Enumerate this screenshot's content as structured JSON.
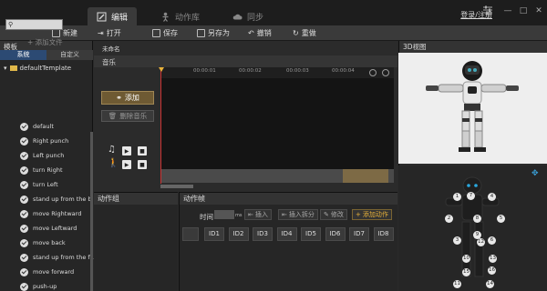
{
  "titlebar": {
    "tabs": [
      {
        "label": "编辑",
        "icon": "edit-icon",
        "active": true
      },
      {
        "label": "动作库",
        "icon": "robot-icon",
        "active": false
      },
      {
        "label": "同步",
        "icon": "cloud-icon",
        "active": false
      }
    ],
    "login": "登录/注册",
    "window_buttons": [
      "settings-icon",
      "minimize-icon",
      "maximize-icon",
      "close-icon"
    ]
  },
  "toolbar": {
    "new": "新建",
    "open": "打开",
    "save": "保存",
    "save_as": "另存为",
    "undo": "撤销",
    "redo": "重做"
  },
  "library": {
    "title": "模板",
    "search_placeholder": "",
    "add_file": "添加文件",
    "tabs": [
      "系统",
      "自定义"
    ],
    "folder": "defaultTemplate",
    "actions": [
      "default",
      "Right punch",
      "Left punch",
      "turn Right",
      "turn Left",
      "stand up from the b...",
      "move Rightward",
      "move Leftward",
      "move back",
      "stand up from the fr...",
      "move forward",
      "push-up"
    ]
  },
  "editor": {
    "project_name": "未命名",
    "music_label": "音乐",
    "add_button": "添加",
    "delete_music_button": "删除音乐",
    "ticks": [
      "00:00:01",
      "00:00:02",
      "00:00:03",
      "00:00:04"
    ]
  },
  "action_group": {
    "title": "动作组"
  },
  "action_frame": {
    "title": "动作帧",
    "time_label": "时间",
    "time_unit": "ms",
    "buttons": {
      "insert": "插入",
      "insert_split": "插入拆分",
      "modify": "修改",
      "add_action": "添加动作"
    },
    "ids": [
      "ID1",
      "ID2",
      "ID3",
      "ID4",
      "ID5",
      "ID6",
      "ID7",
      "ID8"
    ]
  },
  "view3d": {
    "title": "3D视图"
  },
  "joints": [
    "1",
    "2",
    "3",
    "4",
    "5",
    "6",
    "7",
    "8",
    "9",
    "10",
    "11",
    "12",
    "13",
    "14",
    "15",
    "16"
  ],
  "colors": {
    "accent": "#e8b23a",
    "selected_tab": "#2c4a73",
    "background": "#2a2a2a"
  }
}
